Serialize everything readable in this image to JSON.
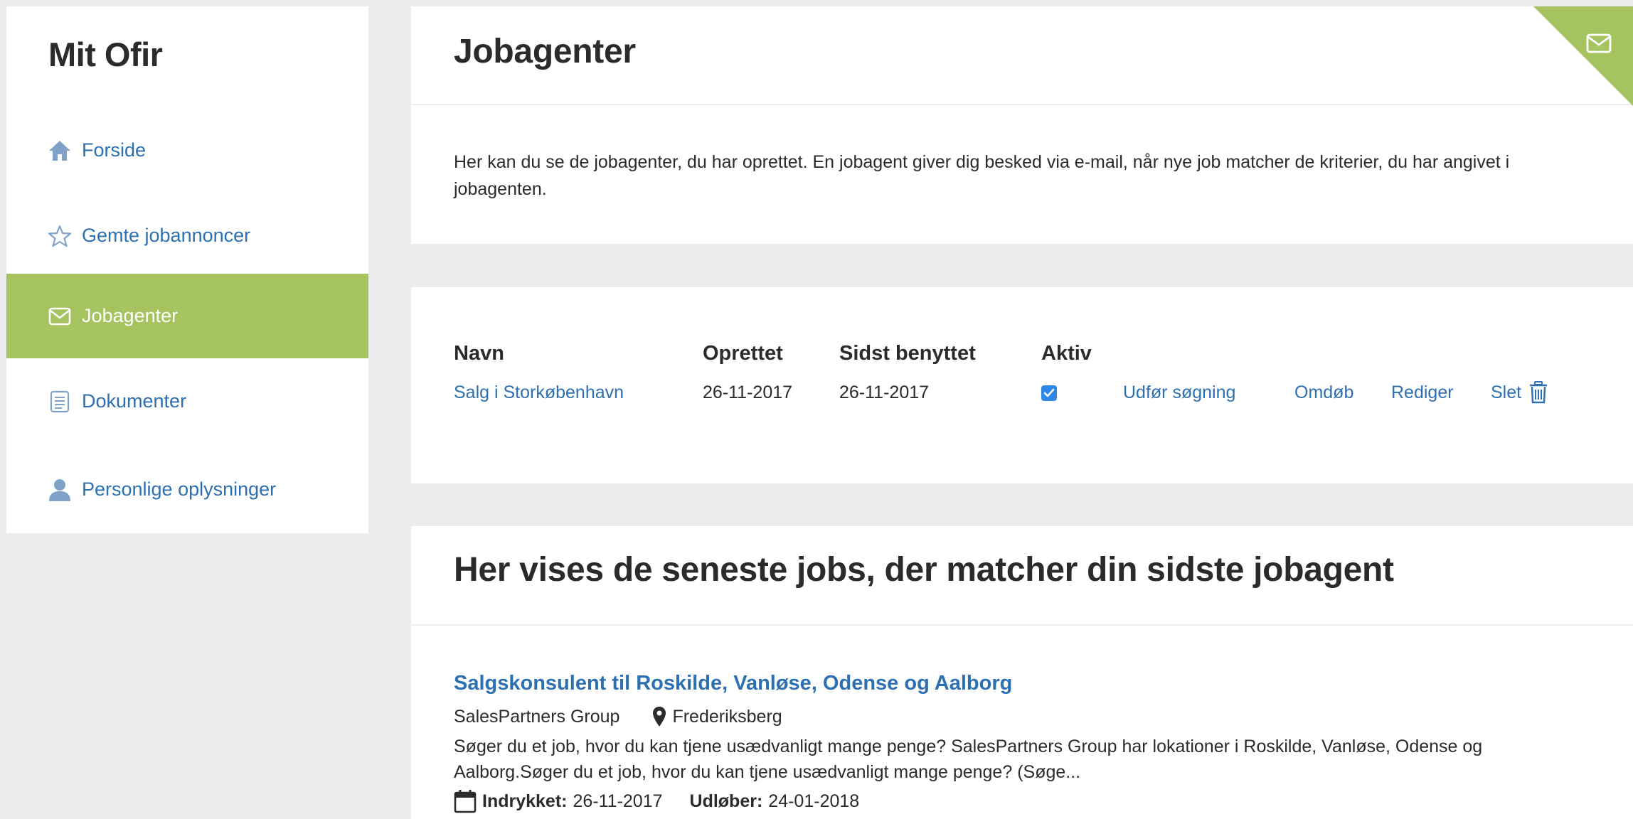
{
  "sidebar": {
    "title": "Mit Ofir",
    "items": [
      {
        "label": "Forside",
        "icon": "home-icon",
        "active": false
      },
      {
        "label": "Gemte jobannoncer",
        "icon": "star-icon",
        "active": false
      },
      {
        "label": "Jobagenter",
        "icon": "envelope-icon",
        "active": true
      },
      {
        "label": "Dokumenter",
        "icon": "document-icon",
        "active": false
      },
      {
        "label": "Personlige oplysninger",
        "icon": "person-icon",
        "active": false
      }
    ]
  },
  "header": {
    "title": "Jobagenter",
    "intro": "Her kan du se de jobagenter, du har oprettet. En jobagent giver dig besked via e-mail, når nye job matcher de kriterier, du har angivet i jobagenten."
  },
  "agents_table": {
    "columns": [
      "Navn",
      "Oprettet",
      "Sidst benyttet",
      "Aktiv"
    ],
    "rows": [
      {
        "name": "Salg i Storkøbenhavn",
        "created": "26-11-2017",
        "last_used": "26-11-2017",
        "active": true,
        "actions": {
          "run": "Udfør søgning",
          "rename": "Omdøb",
          "edit": "Rediger",
          "delete": "Slet"
        }
      }
    ]
  },
  "jobs": {
    "title": "Her vises de seneste jobs, der matcher din sidste jobagent",
    "items": [
      {
        "title": "Salgskonsulent til Roskilde, Vanløse, Odense og Aalborg",
        "company": "SalesPartners Group",
        "location": "Frederiksberg",
        "description": "Søger du et job, hvor du kan tjene usædvanligt mange penge? SalesPartners Group har lokationer i Roskilde, Vanløse, Odense og Aalborg.Søger du et job, hvor du kan tjene usædvanligt mange penge? (Søge...",
        "printed_label": "Indrykket:",
        "printed": "26-11-2017",
        "expires_label": "Udløber:",
        "expires": "24-01-2018"
      }
    ]
  },
  "colors": {
    "accent_green": "#a5c35e",
    "link_blue": "#2d70b1",
    "background": "#ececec"
  }
}
